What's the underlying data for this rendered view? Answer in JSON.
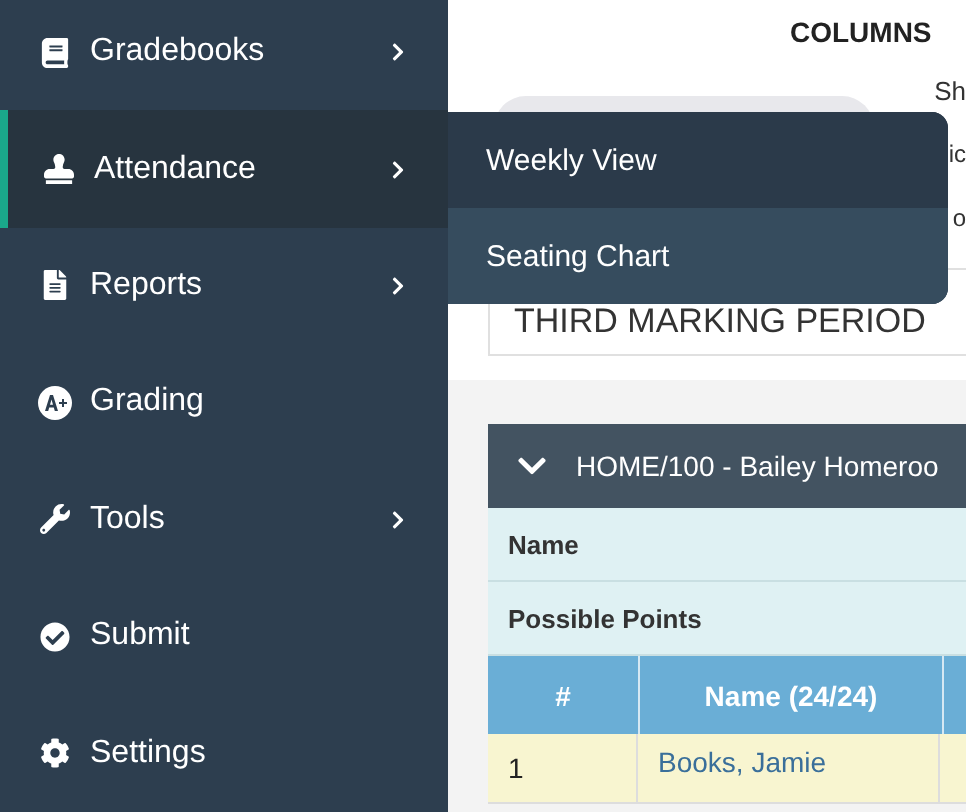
{
  "sidebar": {
    "items": [
      {
        "label": "Gradebooks",
        "selected": false,
        "has_submenu": true
      },
      {
        "label": "Attendance",
        "selected": true,
        "has_submenu": true
      },
      {
        "label": "Reports",
        "selected": false,
        "has_submenu": true
      },
      {
        "label": "Grading",
        "selected": false,
        "has_submenu": false
      },
      {
        "label": "Tools",
        "selected": false,
        "has_submenu": true
      },
      {
        "label": "Submit",
        "selected": false,
        "has_submenu": false
      },
      {
        "label": "Settings",
        "selected": false,
        "has_submenu": false
      }
    ]
  },
  "submenu": {
    "items": [
      {
        "label": "Weekly View",
        "selected": false
      },
      {
        "label": "Seating Chart",
        "selected": true
      }
    ]
  },
  "columns_panel": {
    "title": "COLUMNS",
    "options": [
      "Sh",
      "ic",
      "o"
    ],
    "marking_period": "THIRD MARKING PERIOD"
  },
  "gradebook": {
    "title": "HOME/100 - Bailey Homeroo",
    "info_rows": [
      "Name",
      "Possible Points"
    ],
    "columns": [
      "#",
      "Name (24/24)"
    ],
    "rows": [
      {
        "number": "1",
        "name": "Books, Jamie"
      }
    ]
  }
}
